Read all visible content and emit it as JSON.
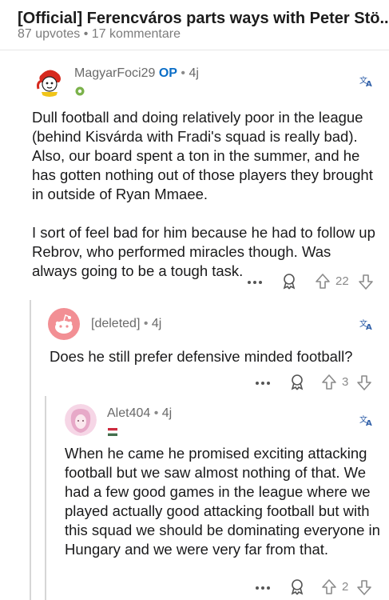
{
  "header": {
    "title": "[Official] Ferencváros parts ways with Peter Stö...",
    "upvotes": "87 upvotes",
    "separator": "•",
    "comments": "17 kommentare"
  },
  "comments": [
    {
      "username": "MagyarFoci29",
      "op_badge": "OP",
      "separator": "•",
      "age": "4j",
      "paragraphs": [
        "Dull football and doing relatively poor in the league (behind Kisvárda with Fradi's squad is really bad). Also, our board spent a ton in the summer, and he has gotten nothing out of those players they brought in outside of Ryan Mmaee.",
        "I sort of feel bad for him because he had to follow up Rebrov, who performed miracles though. Was always going to be a tough task."
      ],
      "votes": "22"
    },
    {
      "username": "[deleted]",
      "separator": "•",
      "age": "4j",
      "paragraphs": [
        "Does he still prefer defensive minded football?"
      ],
      "votes": "3"
    },
    {
      "username": "Alet404",
      "separator": "•",
      "age": "4j",
      "paragraphs": [
        "When he came he promised exciting attacking football but we saw almost nothing of that. We had a few good games in the league where we played actually good attacking football but with this squad we should be dominating everyone in Hungary and we were very far from that."
      ],
      "votes": "2"
    }
  ],
  "icons": {
    "more": "more-options-icon",
    "award": "award-icon",
    "upvote": "upvote-arrow-icon",
    "downvote": "downvote-arrow-icon",
    "translate": "translate-icon",
    "flair_hungary": "hungary-flag-icon"
  },
  "colors": {
    "op": "#0b6ec7",
    "meta": "#7c7c7c",
    "thread_line": "#d6d6d6",
    "deleted_avatar": "#f28f94"
  }
}
